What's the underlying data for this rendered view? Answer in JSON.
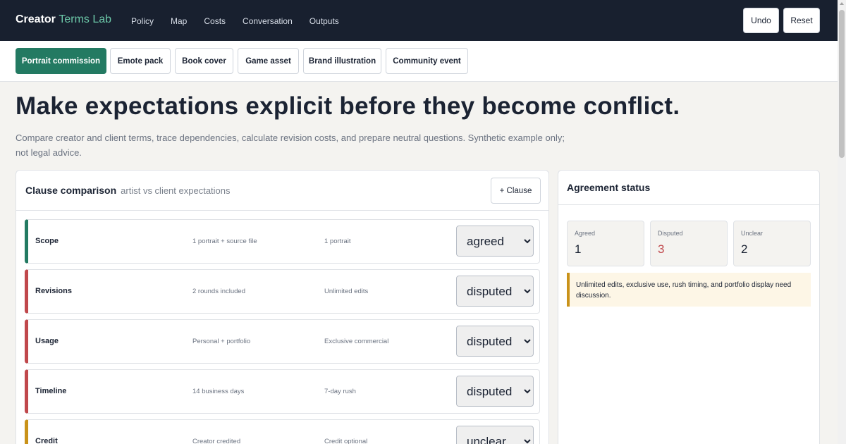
{
  "app": {
    "brand_main": "Creator",
    "brand_accent": "Terms Lab",
    "nav": [
      "Policy",
      "Map",
      "Costs",
      "Conversation",
      "Outputs"
    ],
    "undo_label": "Undo",
    "reset_label": "Reset"
  },
  "scenarios": {
    "active": "Portrait commission",
    "items": [
      "Portrait commission",
      "Emote pack",
      "Book cover",
      "Game asset",
      "Brand illustration",
      "Community event"
    ]
  },
  "hero": {
    "title": "Make expectations explicit before they become conflict.",
    "subtitle": "Compare creator and client terms, trace dependencies, calculate revision costs, and prepare neutral questions. Synthetic example only; not legal advice."
  },
  "clauses": {
    "title": "Clause comparison",
    "subtitle": "artist vs client expectations",
    "add_label": "+ Clause",
    "status_options": [
      "agreed",
      "disputed",
      "unclear"
    ],
    "rows": [
      {
        "name": "Scope",
        "creator": "1 portrait + source file",
        "client": "1 portrait",
        "status": "agreed"
      },
      {
        "name": "Revisions",
        "creator": "2 rounds included",
        "client": "Unlimited edits",
        "status": "disputed"
      },
      {
        "name": "Usage",
        "creator": "Personal + portfolio",
        "client": "Exclusive commercial",
        "status": "disputed"
      },
      {
        "name": "Timeline",
        "creator": "14 business days",
        "client": "7-day rush",
        "status": "disputed"
      },
      {
        "name": "Credit",
        "creator": "Creator credited",
        "client": "Credit optional",
        "status": "unclear"
      }
    ]
  },
  "status": {
    "title": "Agreement status",
    "agreed_label": "Agreed",
    "agreed_value": "1",
    "disputed_label": "Disputed",
    "disputed_value": "3",
    "unclear_label": "Unclear",
    "unclear_value": "2",
    "note": "Unlimited edits, exclusive use, rush timing, and portfolio display need discussion."
  },
  "colors": {
    "topbar": "#18202f",
    "accent": "#237a62",
    "agreed": "#237a62",
    "disputed": "#c0484c",
    "unclear": "#c99219"
  }
}
